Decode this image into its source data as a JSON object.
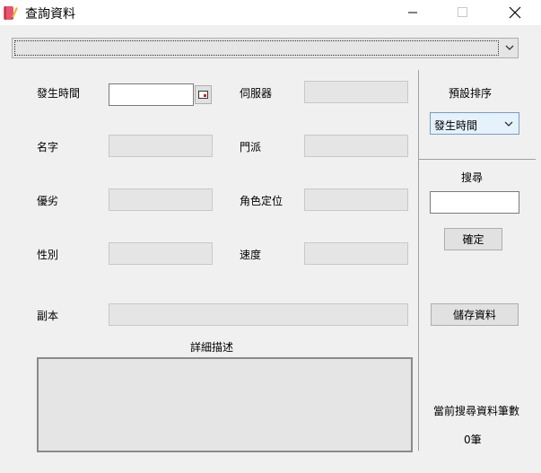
{
  "window": {
    "title": "查詢資料"
  },
  "filter_combo": {
    "value": ""
  },
  "form": {
    "time_label": "發生時間",
    "server_label": "伺服器",
    "name_label": "名字",
    "sect_label": "門派",
    "quality_label": "優劣",
    "role_label": "角色定位",
    "gender_label": "性別",
    "speed_label": "速度",
    "dungeon_label": "副本",
    "detail_label": "詳細描述"
  },
  "sidebar": {
    "sort_label": "預設排序",
    "sort_value": "發生時間",
    "search_label": "搜尋",
    "search_value": "",
    "confirm_label": "確定",
    "save_label": "儲存資料",
    "count_label": "當前搜尋資料筆數",
    "count_value": "0筆"
  }
}
